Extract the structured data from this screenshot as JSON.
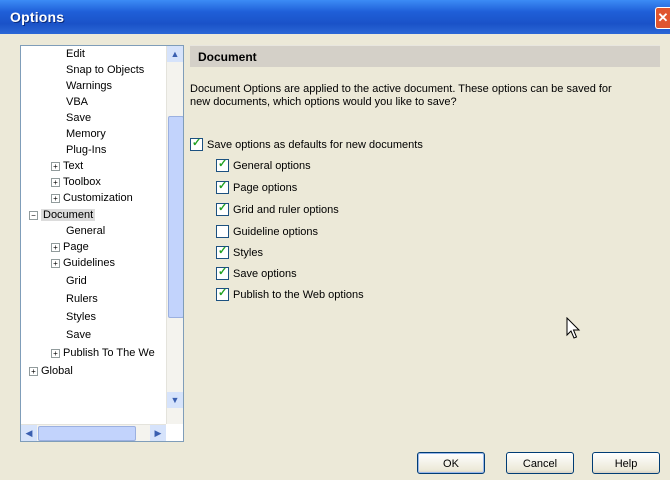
{
  "window": {
    "title": "Options",
    "close_glyph": "✕"
  },
  "tree": {
    "items": [
      {
        "label": "Edit"
      },
      {
        "label": "Snap to Objects"
      },
      {
        "label": "Warnings"
      },
      {
        "label": "VBA"
      },
      {
        "label": "Save"
      },
      {
        "label": "Memory"
      },
      {
        "label": "Plug-Ins"
      },
      {
        "label": "Text"
      },
      {
        "label": "Toolbox"
      },
      {
        "label": "Customization"
      },
      {
        "label": "Document"
      },
      {
        "label": "General"
      },
      {
        "label": "Page"
      },
      {
        "label": "Guidelines"
      },
      {
        "label": "Grid"
      },
      {
        "label": "Rulers"
      },
      {
        "label": "Styles"
      },
      {
        "label": "Save"
      },
      {
        "label": "Publish To The We"
      },
      {
        "label": "Global"
      }
    ],
    "expand_glyph_plus": "+",
    "expand_glyph_minus": "−"
  },
  "panel": {
    "header": "Document",
    "description": "Document Options are applied to the active document. These options can be saved for new documents, which options would you like to save?",
    "main_option": {
      "label": "Save options as defaults for new documents",
      "checked": true
    },
    "options": [
      {
        "label": "General options",
        "checked": true
      },
      {
        "label": "Page options",
        "checked": true
      },
      {
        "label": "Grid and ruler options",
        "checked": true
      },
      {
        "label": "Guideline options",
        "checked": false
      },
      {
        "label": "Styles",
        "checked": true
      },
      {
        "label": "Save options",
        "checked": true
      },
      {
        "label": "Publish to the Web options",
        "checked": true
      }
    ]
  },
  "buttons": {
    "ok": "OK",
    "cancel": "Cancel",
    "help": "Help"
  },
  "scroll": {
    "up": "▲",
    "down": "▼",
    "left": "◀",
    "right": "▶"
  }
}
